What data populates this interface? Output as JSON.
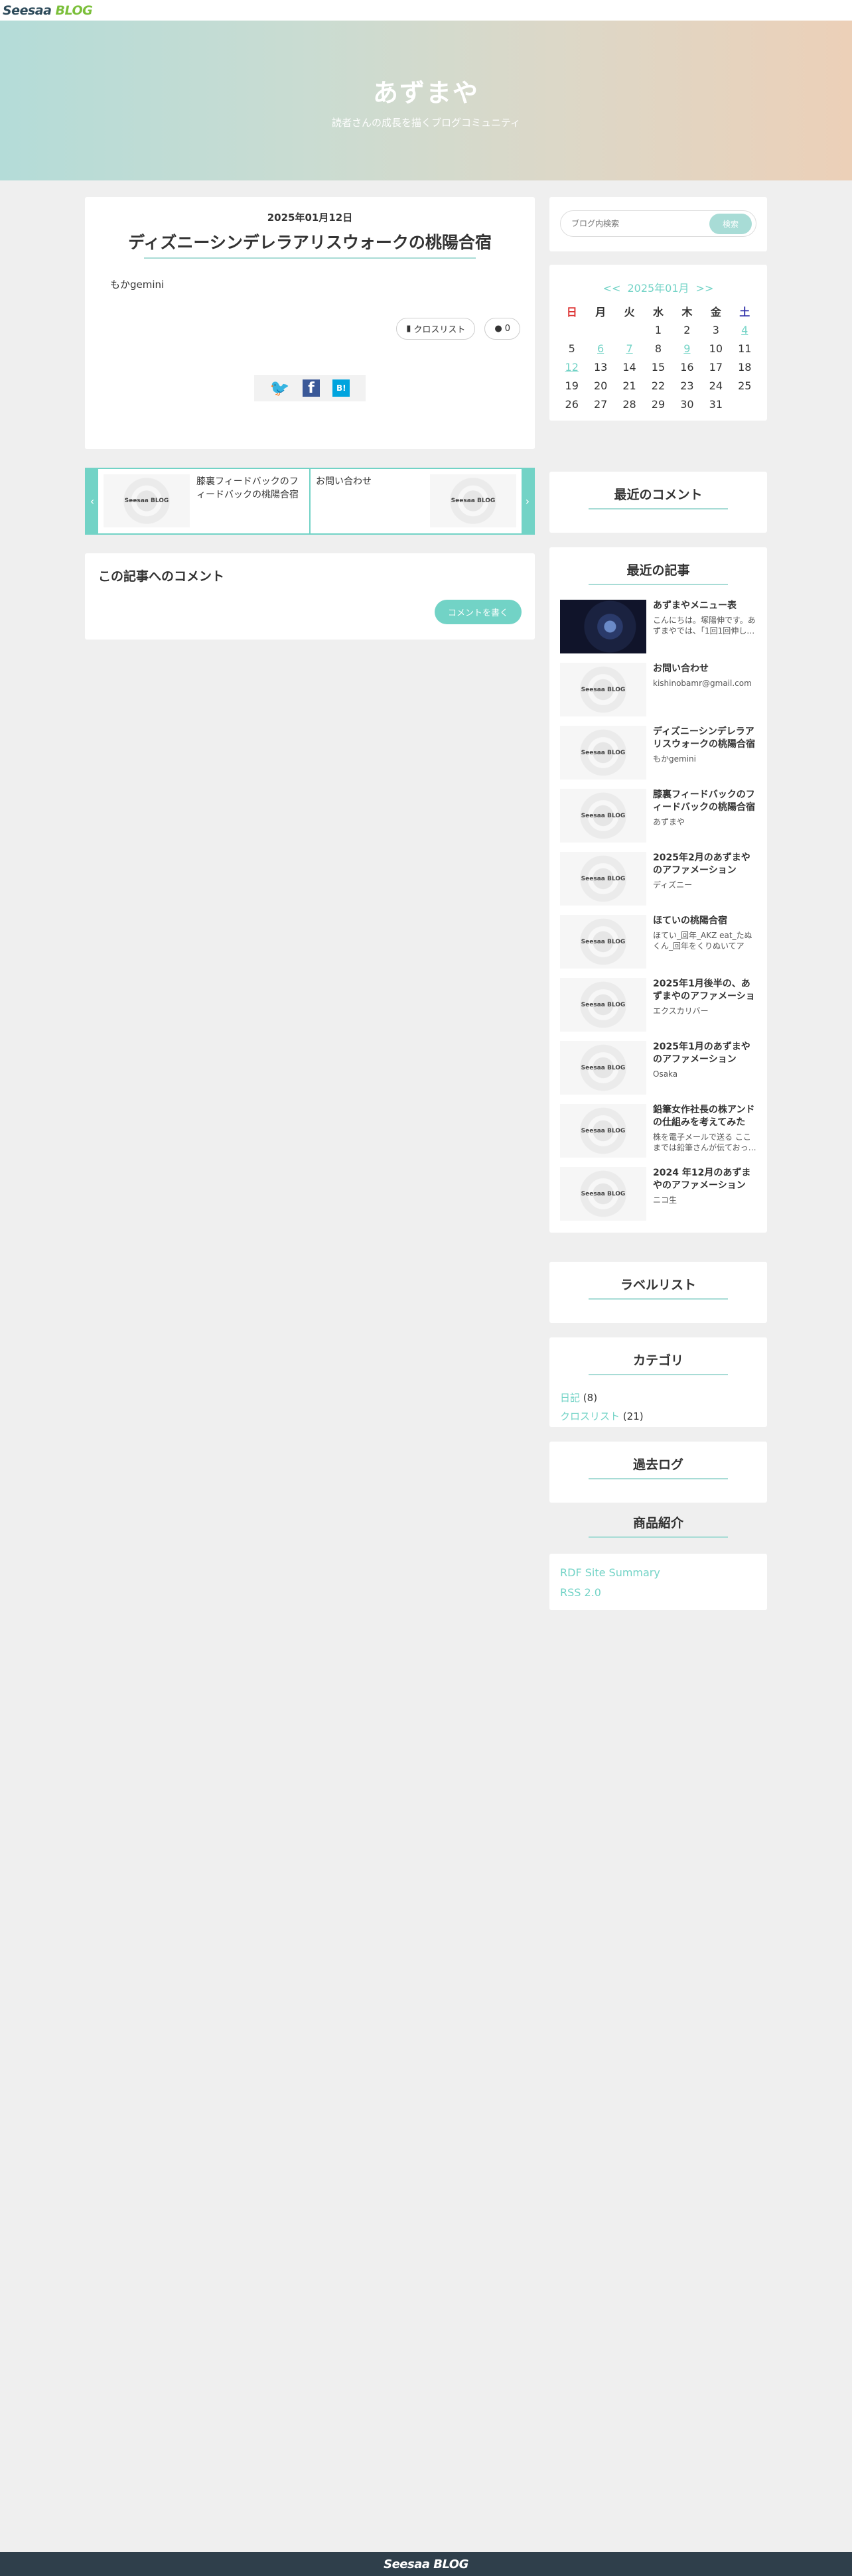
{
  "topbar": {
    "logo_part1": "Seesaa",
    "logo_part2": "BLOG"
  },
  "hero": {
    "title": "あずまや",
    "subtitle": "読者さんの成長を描くブログコミュニティ"
  },
  "article": {
    "date": "2025年01月12日",
    "title": "ディズニーシンデレラアリスウォークの桃陽合宿",
    "body": "もかgemini",
    "category_label": "クロスリスト",
    "comment_count": "0"
  },
  "post_nav": {
    "prev_title": "膝裏フィードバックのフィードバックの桃陽合宿",
    "next_title": "お問い合わせ",
    "thumb_text": "Seesaa BLOG"
  },
  "comments": {
    "title": "この記事へのコメント",
    "button": "コメントを書く"
  },
  "search": {
    "placeholder": "ブログ内検索",
    "button": "検索"
  },
  "calendar": {
    "prev": "<<",
    "month": "2025年01月",
    "next": ">>",
    "weekdays": [
      "日",
      "月",
      "火",
      "水",
      "木",
      "金",
      "土"
    ],
    "rows": [
      [
        "",
        "",
        "",
        "1",
        "2",
        "3",
        "4"
      ],
      [
        "5",
        "6",
        "7",
        "8",
        "9",
        "10",
        "11"
      ],
      [
        "12",
        "13",
        "14",
        "15",
        "16",
        "17",
        "18"
      ],
      [
        "19",
        "20",
        "21",
        "22",
        "23",
        "24",
        "25"
      ],
      [
        "26",
        "27",
        "28",
        "29",
        "30",
        "31",
        ""
      ]
    ]
  },
  "widgets": {
    "recent_comments": "最近のコメント",
    "recent_posts": "最近の記事",
    "labels": "ラベルリスト",
    "category": "カテゴリ",
    "archive": "過去ログ",
    "products": "商品紹介"
  },
  "recent_posts": [
    {
      "title": "あずまやメニュー表",
      "desc": "こんにちは。塚陽伸です。あずまやでは、「1回1回伸し…"
    },
    {
      "title": "お問い合わせ",
      "desc": "kishinobamr@gmail.com"
    },
    {
      "title": "ディズニーシンデレラアリスウォークの桃陽合宿",
      "desc": "もかgemini"
    },
    {
      "title": "膝裏フィードバックのフィードバックの桃陽合宿",
      "desc": "あずまや"
    },
    {
      "title": "2025年2月のあずまやのアファメーション",
      "desc": "ディズニー"
    },
    {
      "title": "ほていの桃陽合宿",
      "desc": "ほてい_回年_AKZ eat_たぬくん_回年をくりぬいてア"
    },
    {
      "title": "2025年1月後半の、あずまやのアファメーション",
      "desc": "エクスカリバー"
    },
    {
      "title": "2025年1月のあずまやのアファメーション",
      "desc": "Osaka"
    },
    {
      "title": "鉛筆女作社長の株アンドの仕組みを考えてみた",
      "desc": "株を電子メールで送る ここまでは鉛筆さんが伝ておっ…"
    },
    {
      "title": "2024 年12月のあずまやのアファメーション",
      "desc": "ニコ生"
    }
  ],
  "categories": [
    {
      "name": "日記",
      "count": "(8)"
    },
    {
      "name": "クロスリスト",
      "count": "(21)"
    }
  ],
  "rss": {
    "link1": "RDF Site Summary",
    "link2": "RSS 2.0"
  },
  "footer": {
    "logo": "Seesaa BLOG"
  },
  "colors": {
    "accent": "#72d3c6",
    "footer_bg": "#2f3f4b"
  }
}
